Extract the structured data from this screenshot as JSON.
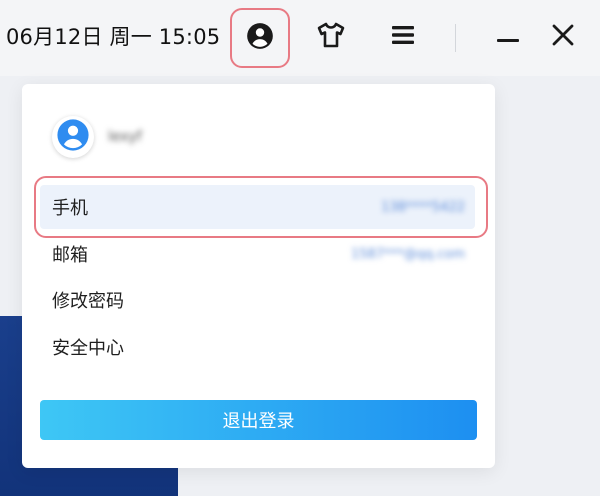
{
  "topbar": {
    "datetime": "06月12日 周一 15:05",
    "icons": [
      "account-circle-icon",
      "shirt-icon",
      "hamburger-menu-icon",
      "minimize-icon",
      "close-icon"
    ]
  },
  "panel": {
    "user": {
      "name": "lexyf"
    },
    "items": [
      {
        "label": "手机",
        "value": "138****5422",
        "active": true
      },
      {
        "label": "邮箱",
        "value": "1587***@qq.com",
        "active": false
      },
      {
        "label": "修改密码",
        "value": "",
        "active": false
      },
      {
        "label": "安全中心",
        "value": "",
        "active": false
      }
    ],
    "logout_label": "退出登录"
  },
  "colors": {
    "accent_start": "#3ec7f5",
    "accent_end": "#1d8ff1",
    "highlight_border": "#e87a84",
    "active_row": "#ecf2fb",
    "avatar_blue": "#2f8cf0"
  }
}
